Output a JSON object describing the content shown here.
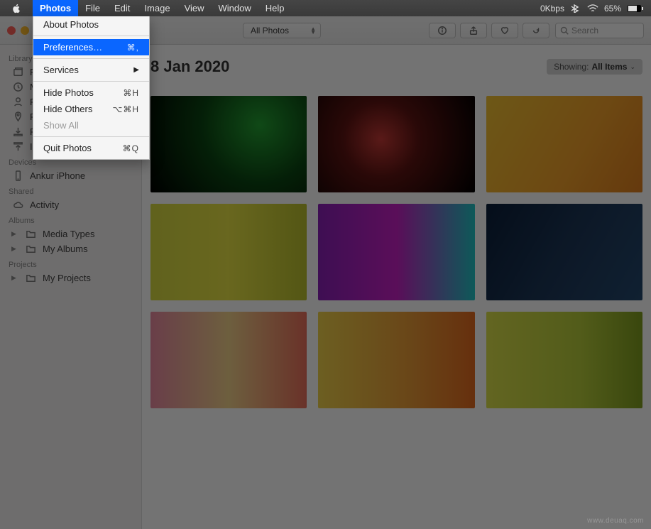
{
  "menubar": {
    "items": [
      "Photos",
      "File",
      "Edit",
      "Image",
      "View",
      "Window",
      "Help"
    ],
    "active_index": 0,
    "status": {
      "net": "0Kbps",
      "battery_pct": "65%"
    }
  },
  "dropdown": {
    "items": [
      {
        "label": "About Photos",
        "shortcut": "",
        "type": "item"
      },
      {
        "type": "sep"
      },
      {
        "label": "Preferences…",
        "shortcut": "⌘,",
        "type": "item",
        "highlight": true
      },
      {
        "type": "sep"
      },
      {
        "label": "Services",
        "shortcut": "",
        "type": "submenu"
      },
      {
        "type": "sep"
      },
      {
        "label": "Hide Photos",
        "shortcut": "⌘H",
        "type": "item"
      },
      {
        "label": "Hide Others",
        "shortcut": "⌥⌘H",
        "type": "item"
      },
      {
        "label": "Show All",
        "shortcut": "",
        "type": "item",
        "disabled": true
      },
      {
        "type": "sep"
      },
      {
        "label": "Quit Photos",
        "shortcut": "⌘Q",
        "type": "item"
      }
    ]
  },
  "toolbar": {
    "view_selector": "All Photos",
    "search_placeholder": "Search"
  },
  "sidebar": {
    "sections": [
      {
        "header": "Library",
        "items": [
          {
            "label": "Photos",
            "icon": "photo-stack-icon",
            "truncated": "P"
          },
          {
            "label": "Memories",
            "icon": "clock-icon",
            "truncated": "M"
          },
          {
            "label": "People",
            "icon": "person-icon",
            "truncated": "P"
          },
          {
            "label": "Places",
            "icon": "pin-icon",
            "truncated": "P"
          },
          {
            "label": "Recents",
            "icon": "download-icon",
            "truncated": "F"
          },
          {
            "label": "Imports",
            "icon": "import-icon"
          }
        ]
      },
      {
        "header": "Devices",
        "items": [
          {
            "label": "Ankur iPhone",
            "icon": "phone-icon"
          }
        ]
      },
      {
        "header": "Shared",
        "items": [
          {
            "label": "Activity",
            "icon": "cloud-icon"
          }
        ]
      },
      {
        "header": "Albums",
        "items": [
          {
            "label": "Media Types",
            "icon": "folder-icon",
            "disclosure": true
          },
          {
            "label": "My Albums",
            "icon": "folder-icon",
            "disclosure": true
          }
        ]
      },
      {
        "header": "Projects",
        "items": [
          {
            "label": "My Projects",
            "icon": "folder-icon",
            "disclosure": true
          }
        ]
      }
    ]
  },
  "content": {
    "date_header": "8 Jan 2020",
    "showing_label": "Showing:",
    "showing_value": "All Items"
  },
  "watermark": "www.deuaq.com"
}
